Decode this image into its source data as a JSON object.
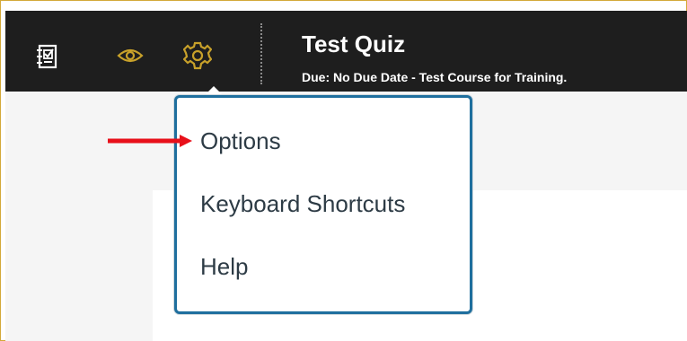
{
  "header": {
    "title": "Test Quiz",
    "subtitle": "Due: No Due Date - Test Course for Training."
  },
  "toolbar": {
    "icons": [
      "quiz-icon",
      "eye-icon",
      "gear-icon"
    ]
  },
  "menu": {
    "items": [
      {
        "label": "Options"
      },
      {
        "label": "Keyboard Shortcuts"
      },
      {
        "label": "Help"
      }
    ]
  },
  "colors": {
    "header_bg": "#1e1e1e",
    "accent_gold": "#c8a12a",
    "menu_border": "#1f6f9e",
    "annotation_arrow": "#e8101a",
    "frame_border": "#d4a93a"
  }
}
